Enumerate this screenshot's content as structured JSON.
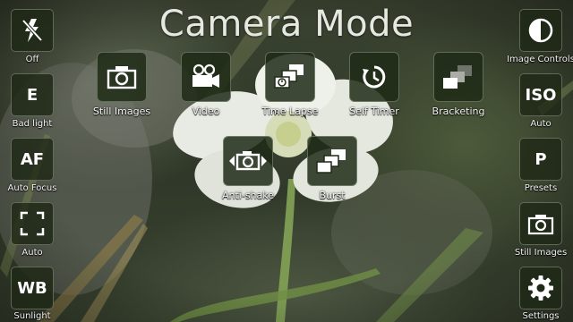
{
  "title": "Camera Mode",
  "left_controls": [
    {
      "label": "Off",
      "icon": "flash-off-icon"
    },
    {
      "label": "Bad light",
      "text": "E"
    },
    {
      "label": "Auto Focus",
      "text": "AF"
    },
    {
      "label": "Auto",
      "icon": "frame-corners-icon"
    },
    {
      "label": "Sunlight",
      "text": "WB"
    }
  ],
  "right_controls": [
    {
      "label": "Image Controls",
      "icon": "contrast-icon"
    },
    {
      "label": "Auto",
      "text": "ISO"
    },
    {
      "label": "Presets",
      "text": "P"
    },
    {
      "label": "Still Images",
      "icon": "camera-icon"
    },
    {
      "label": "Settings",
      "icon": "gear-icon"
    }
  ],
  "modes": [
    {
      "label": "Still Images",
      "icon": "camera-icon"
    },
    {
      "label": "Video",
      "icon": "video-camera-icon"
    },
    {
      "label": "Time Lapse",
      "icon": "time-lapse-icon"
    },
    {
      "label": "Self Timer",
      "icon": "self-timer-icon"
    },
    {
      "label": "Bracketing",
      "icon": "bracketing-icon"
    },
    {
      "label": "Anti-shake",
      "icon": "anti-shake-icon"
    },
    {
      "label": "Burst",
      "icon": "burst-icon"
    }
  ],
  "colors": {
    "tile_bg": "#1e2a16",
    "text": "#ffffff"
  }
}
